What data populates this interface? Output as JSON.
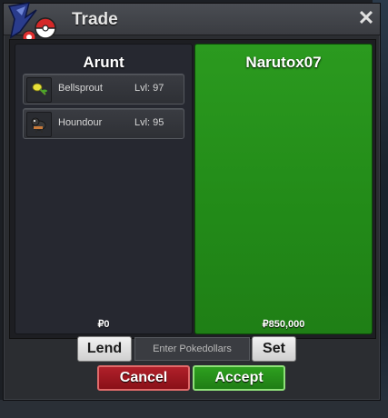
{
  "window": {
    "title": "Trade",
    "close_glyph": "✕"
  },
  "left_panel": {
    "player_name": "Arunt",
    "money": "₽0",
    "pokemon": [
      {
        "name": "Bellsprout",
        "level": "Lvl: 97",
        "icon": "bellsprout-icon"
      },
      {
        "name": "Houndour",
        "level": "Lvl: 95",
        "icon": "houndour-icon"
      }
    ]
  },
  "right_panel": {
    "player_name": "Narutox07",
    "money": "₽850,000"
  },
  "controls": {
    "lend_label": "Lend",
    "money_placeholder": "Enter Pokedollars",
    "set_label": "Set",
    "cancel_label": "Cancel",
    "accept_label": "Accept"
  },
  "colors": {
    "accept_green": "#228a18",
    "cancel_red": "#a01820"
  }
}
